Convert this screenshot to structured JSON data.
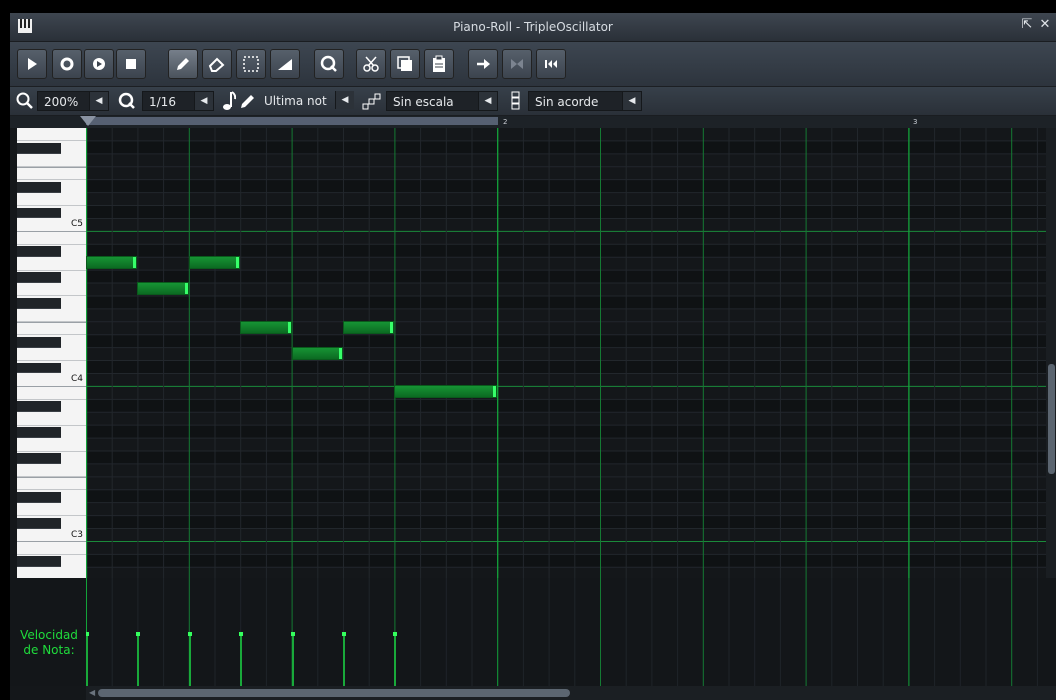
{
  "window": {
    "title": "Piano-Roll - TripleOscillator",
    "app_icon": "piano-keys-icon",
    "controls": [
      "restore-icon",
      "close-icon"
    ]
  },
  "toolbar": {
    "buttons": [
      {
        "name": "play-button",
        "icon": "play-icon"
      },
      {
        "name": "record-button",
        "icon": "record-icon"
      },
      {
        "name": "record-while-playing-button",
        "icon": "record-play-icon"
      },
      {
        "name": "stop-button",
        "icon": "stop-icon"
      },
      {
        "name": "draw-mode-button",
        "icon": "pencil-icon",
        "active": true
      },
      {
        "name": "erase-mode-button",
        "icon": "eraser-icon"
      },
      {
        "name": "select-mode-button",
        "icon": "select-rect-icon"
      },
      {
        "name": "pitch-bend-mode-button",
        "icon": "wedge-icon"
      },
      {
        "name": "quantize-button",
        "icon": "q-icon"
      },
      {
        "name": "cut-button",
        "icon": "scissors-icon"
      },
      {
        "name": "copy-button",
        "icon": "copy-icon"
      },
      {
        "name": "paste-button",
        "icon": "paste-icon"
      },
      {
        "name": "stop-behaviour-button",
        "icon": "arrow-right-icon"
      },
      {
        "name": "back-to-start-button",
        "icon": "bowtie-icon",
        "disabled": true
      },
      {
        "name": "back-to-zero-button",
        "icon": "rewind-icon"
      }
    ]
  },
  "options": {
    "zoom": "200%",
    "quantize": "1/16",
    "note_length": "Ultima not",
    "scale": "Sin escala",
    "chord": "Sin acorde"
  },
  "timeline": {
    "bar_labels": [
      "2",
      "3"
    ]
  },
  "keyboard": {
    "octave_labels": [
      "C5",
      "C4",
      "C3"
    ]
  },
  "notes": [
    {
      "pitch": 69,
      "start": 0,
      "length": 2
    },
    {
      "pitch": 67,
      "start": 2,
      "length": 2
    },
    {
      "pitch": 69,
      "start": 4,
      "length": 2
    },
    {
      "pitch": 64,
      "start": 6,
      "length": 2
    },
    {
      "pitch": 62,
      "start": 8,
      "length": 2
    },
    {
      "pitch": 64,
      "start": 10,
      "length": 2
    },
    {
      "pitch": 59,
      "start": 12,
      "length": 4
    }
  ],
  "velocity": {
    "label": "Velocidad de Nota:",
    "values": [
      100,
      100,
      100,
      100,
      100,
      100,
      100
    ]
  },
  "colors": {
    "accent": "#1fdc3c",
    "note_fill": "#108a2b",
    "grid_bar_line": "#13a33a"
  }
}
